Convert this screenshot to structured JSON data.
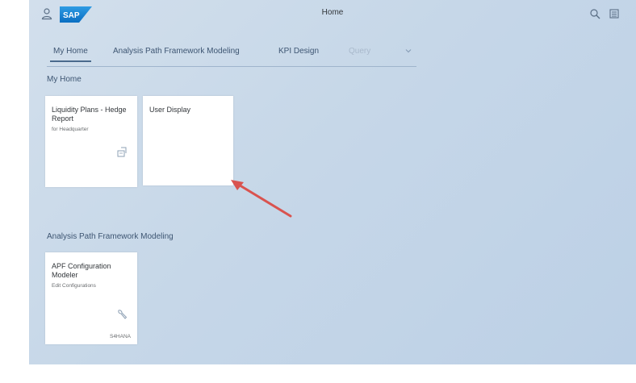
{
  "shell": {
    "title": "Home",
    "icons": {
      "user": "user-icon",
      "logo": "sap-logo",
      "search": "search-icon",
      "menu": "menu-icon"
    }
  },
  "tabs": [
    {
      "label": "My Home",
      "selected": true
    },
    {
      "label": "Analysis Path Framework Modeling",
      "selected": false
    },
    {
      "label": "KPI Design",
      "selected": false
    },
    {
      "label": "Query",
      "selected": false
    }
  ],
  "sections": [
    {
      "title": "My Home",
      "tiles": [
        {
          "title": "Liquidity Plans - Hedge Report",
          "subtitle": "for Headquarter",
          "icon": "report-icon"
        },
        {
          "title": "User Display",
          "subtitle": "",
          "icon": ""
        }
      ]
    },
    {
      "title": "Analysis Path Framework Modeling",
      "tiles": [
        {
          "title": "APF Configuration Modeler",
          "subtitle": "Edit Configurations",
          "icon": "wrench-icon",
          "footer": "S4HANA"
        }
      ]
    }
  ],
  "colors": {
    "background": "#c6d7e8",
    "accent": "#3d5572",
    "annotation_arrow": "#d9534f"
  }
}
